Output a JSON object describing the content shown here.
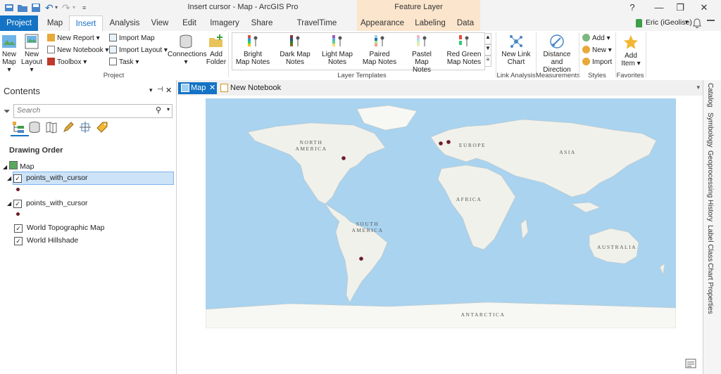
{
  "window": {
    "title": "Insert cursor - Map - ArcGIS Pro",
    "context_band": "Feature Layer",
    "help": "?",
    "minimize": "—",
    "restore": "❐",
    "close": "✕"
  },
  "tabs": [
    "Project",
    "Map",
    "Insert",
    "Analysis",
    "View",
    "Edit",
    "Imagery",
    "Share",
    "TravelTime platform",
    "Appearance",
    "Labeling",
    "Data"
  ],
  "active_tab": "Insert",
  "user": {
    "name": "Eric (iGeolise)",
    "caret": "▾"
  },
  "ribbon": {
    "project": {
      "new_map": [
        "New",
        "Map ▾"
      ],
      "new_layout": [
        "New",
        "Layout ▾"
      ],
      "new_report": "New Report ▾",
      "new_notebook": "New Notebook ▾",
      "toolbox": "Toolbox ▾",
      "import_map": "Import Map",
      "import_layout": "Import Layout ▾",
      "task": "Task ▾",
      "connections": [
        "Connections",
        "▾"
      ],
      "add_folder": [
        "Add",
        "Folder"
      ],
      "group_label": "Project"
    },
    "layer_templates": {
      "items": [
        [
          "Bright",
          "Map Notes"
        ],
        [
          "Dark Map",
          "Notes"
        ],
        [
          "Light Map",
          "Notes"
        ],
        [
          "Paired",
          "Map Notes"
        ],
        [
          "Pastel Map",
          "Notes"
        ],
        [
          "Red Green",
          "Map Notes"
        ]
      ],
      "group_label": "Layer Templates"
    },
    "link_analysis": {
      "new_link_chart": [
        "New Link",
        "Chart"
      ],
      "group_label": "Link Analysis"
    },
    "measurements": {
      "distance_direction": [
        "Distance and",
        "Direction"
      ],
      "group_label": "Measurements"
    },
    "styles": {
      "add": "Add ▾",
      "new": "New ▾",
      "import": "Import",
      "group_label": "Styles"
    },
    "favorites": {
      "add_item": [
        "Add",
        "Item ▾"
      ],
      "group_label": "Favorites"
    }
  },
  "contents": {
    "title": "Contents",
    "search_placeholder": "Search",
    "drawing_order": "Drawing Order",
    "map": "Map",
    "layers": [
      "points_with_cursor",
      "points_with_cursor",
      "World Topographic Map",
      "World Hillshade"
    ]
  },
  "view_tabs": {
    "map": "Map",
    "notebook": "New Notebook"
  },
  "right_tabs": [
    "Catalog",
    "Symbology",
    "Geoprocessing",
    "History",
    "Label Class",
    "Chart Properties"
  ],
  "map_labels": {
    "north_america": [
      "NORTH",
      "AMERICA"
    ],
    "south_america": [
      "SOUTH",
      "AMERICA"
    ],
    "europe": "EUROPE",
    "asia": "ASIA",
    "africa": "AFRICA",
    "australia": "AUSTRALIA",
    "antarctica": "ANTARCTICA"
  },
  "colors": {
    "accent": "#1473c5",
    "context": "#fbe5cc",
    "ocean": "#a9d3ef",
    "land": "#f1f1ec",
    "point": "#6b1d2a"
  }
}
